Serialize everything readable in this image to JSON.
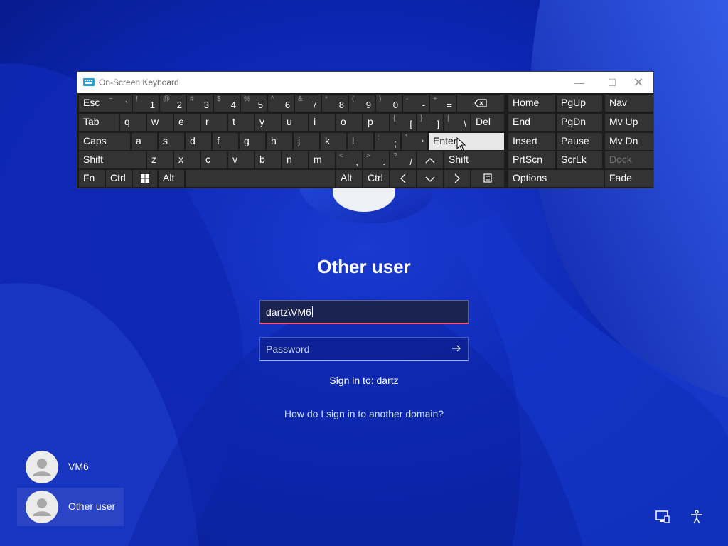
{
  "osk": {
    "title": "On-Screen Keyboard",
    "icons": {
      "app": "keyboard-icon",
      "minimize": "minimize-icon",
      "maximize": "maximize-icon",
      "close": "close-icon"
    },
    "rows": [
      [
        {
          "id": "esc",
          "label": "Esc"
        },
        {
          "id": "backtick",
          "pri": "`",
          "sec": "~"
        },
        {
          "id": "1",
          "pri": "1",
          "sec": "!"
        },
        {
          "id": "2",
          "pri": "2",
          "sec": "@"
        },
        {
          "id": "3",
          "pri": "3",
          "sec": "#"
        },
        {
          "id": "4",
          "pri": "4",
          "sec": "$"
        },
        {
          "id": "5",
          "pri": "5",
          "sec": "%"
        },
        {
          "id": "6",
          "pri": "6",
          "sec": "^"
        },
        {
          "id": "7",
          "pri": "7",
          "sec": "&"
        },
        {
          "id": "8",
          "pri": "8",
          "sec": "*"
        },
        {
          "id": "9",
          "pri": "9",
          "sec": "("
        },
        {
          "id": "0",
          "pri": "0",
          "sec": ")"
        },
        {
          "id": "minus",
          "pri": "-",
          "sec": "-"
        },
        {
          "id": "equals",
          "pri": "=",
          "sec": "+"
        },
        {
          "id": "backspace",
          "icon": "backspace-icon"
        },
        {
          "id": "home",
          "label": "Home"
        },
        {
          "id": "pgup",
          "label": "PgUp"
        },
        {
          "id": "nav",
          "label": "Nav"
        }
      ],
      [
        {
          "id": "tab",
          "label": "Tab"
        },
        {
          "id": "q",
          "label": "q"
        },
        {
          "id": "w",
          "label": "w"
        },
        {
          "id": "e",
          "label": "e"
        },
        {
          "id": "r",
          "label": "r"
        },
        {
          "id": "t",
          "label": "t"
        },
        {
          "id": "y",
          "label": "y"
        },
        {
          "id": "u",
          "label": "u"
        },
        {
          "id": "i",
          "label": "i"
        },
        {
          "id": "o",
          "label": "o"
        },
        {
          "id": "p",
          "label": "p"
        },
        {
          "id": "lbracket",
          "pri": "[",
          "sec": "{"
        },
        {
          "id": "rbracket",
          "pri": "]",
          "sec": "}"
        },
        {
          "id": "backslash",
          "pri": "\\",
          "sec": "|"
        },
        {
          "id": "del",
          "label": "Del"
        },
        {
          "id": "end",
          "label": "End"
        },
        {
          "id": "pgdn",
          "label": "PgDn"
        },
        {
          "id": "mvup",
          "label": "Mv Up"
        }
      ],
      [
        {
          "id": "caps",
          "label": "Caps"
        },
        {
          "id": "a",
          "label": "a"
        },
        {
          "id": "s",
          "label": "s"
        },
        {
          "id": "d",
          "label": "d"
        },
        {
          "id": "f",
          "label": "f"
        },
        {
          "id": "g",
          "label": "g"
        },
        {
          "id": "h",
          "label": "h"
        },
        {
          "id": "j",
          "label": "j"
        },
        {
          "id": "k",
          "label": "k"
        },
        {
          "id": "l",
          "label": "l"
        },
        {
          "id": "semicolon",
          "pri": ";",
          "sec": ":"
        },
        {
          "id": "quote",
          "pri": "'",
          "sec": "\""
        },
        {
          "id": "enter",
          "label": "Enter"
        },
        {
          "id": "insert",
          "label": "Insert"
        },
        {
          "id": "pause",
          "label": "Pause"
        },
        {
          "id": "mvdn",
          "label": "Mv Dn"
        }
      ],
      [
        {
          "id": "lshift",
          "label": "Shift"
        },
        {
          "id": "z",
          "label": "z"
        },
        {
          "id": "x",
          "label": "x"
        },
        {
          "id": "c",
          "label": "c"
        },
        {
          "id": "v",
          "label": "v"
        },
        {
          "id": "b",
          "label": "b"
        },
        {
          "id": "n",
          "label": "n"
        },
        {
          "id": "m",
          "label": "m"
        },
        {
          "id": "comma",
          "pri": ",",
          "sec": "<"
        },
        {
          "id": "period",
          "pri": ".",
          "sec": ">"
        },
        {
          "id": "slash",
          "pri": "/",
          "sec": "?"
        },
        {
          "id": "up",
          "icon": "arrow-up-icon"
        },
        {
          "id": "rshift",
          "label": "Shift"
        },
        {
          "id": "prtscn",
          "label": "PrtScn"
        },
        {
          "id": "scrlk",
          "label": "ScrLk"
        },
        {
          "id": "dock",
          "label": "Dock",
          "disabled": true
        }
      ],
      [
        {
          "id": "fn",
          "label": "Fn"
        },
        {
          "id": "lctrl",
          "label": "Ctrl"
        },
        {
          "id": "win",
          "icon": "windows-logo-icon"
        },
        {
          "id": "lalt",
          "label": "Alt"
        },
        {
          "id": "space",
          "label": ""
        },
        {
          "id": "ralt",
          "label": "Alt"
        },
        {
          "id": "rctrl",
          "label": "Ctrl"
        },
        {
          "id": "left",
          "icon": "arrow-left-icon"
        },
        {
          "id": "down",
          "icon": "arrow-down-icon"
        },
        {
          "id": "right",
          "icon": "arrow-right-icon"
        },
        {
          "id": "menu",
          "icon": "context-menu-icon"
        },
        {
          "id": "options",
          "label": "Options"
        },
        {
          "id": "fade",
          "label": "Fade"
        }
      ]
    ]
  },
  "login": {
    "title": "Other user",
    "username_value": "dartz\\VM6",
    "password_placeholder": "Password",
    "submit_icon": "arrow-right-icon",
    "sign_in_to": "Sign in to: dartz",
    "domain_help_link": "How do I sign in to another domain?"
  },
  "users": [
    {
      "name": "VM6",
      "selected": false
    },
    {
      "name": "Other user",
      "selected": true
    }
  ],
  "corner": {
    "network_icon": "network-icon",
    "accessibility_icon": "accessibility-icon"
  },
  "colors": {
    "wallpaper": "#0a1fa8",
    "key_bg": "#333333",
    "enter_highlight": "#e8e8e8",
    "username_underline": "#ff5560"
  }
}
